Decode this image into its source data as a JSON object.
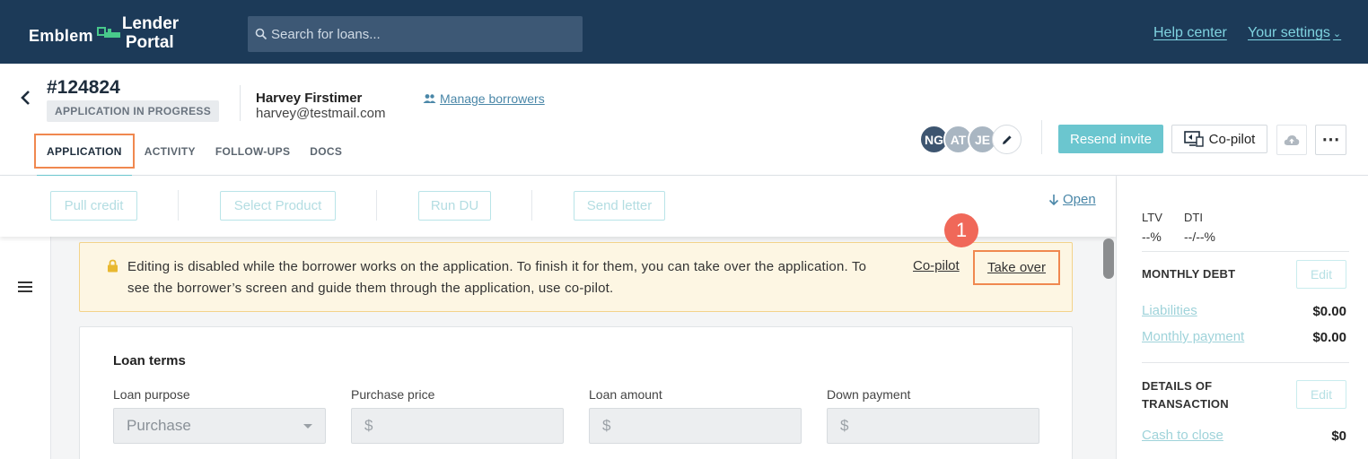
{
  "topbar": {
    "logo_emblem": "Emblem",
    "logo_line1": "Lender",
    "logo_line2": "Portal",
    "search_placeholder": "Search for loans...",
    "help_label": "Help center",
    "settings_label": "Your settings"
  },
  "header": {
    "loan_id": "#124824",
    "status": "APPLICATION IN PROGRESS",
    "borrower_name": "Harvey Firstimer",
    "borrower_email": "harvey@testmail.com",
    "manage_label": "Manage borrowers",
    "tabs": [
      {
        "label": "APPLICATION"
      },
      {
        "label": "ACTIVITY"
      },
      {
        "label": "FOLLOW-UPS"
      },
      {
        "label": "DOCS"
      }
    ],
    "avatars": [
      "NG",
      "AT",
      "JE"
    ],
    "resend_label": "Resend invite",
    "copilot_label": "Co-pilot"
  },
  "actions": {
    "pull_credit": "Pull credit",
    "select_product": "Select Product",
    "run_du": "Run DU",
    "send_letter": "Send letter",
    "open_label": "Open"
  },
  "notice": {
    "text": "Editing is disabled while the borrower works on the application. To finish it for them, you can take over the application. To see the borrower’s screen and guide them through the application, use co-pilot.",
    "copilot_link": "Co-pilot",
    "takeover_label": "Take over",
    "step_number": "1"
  },
  "loan_terms": {
    "title": "Loan terms",
    "fields": [
      {
        "label": "Loan purpose",
        "value": "Purchase"
      },
      {
        "label": "Purchase price",
        "value": "$"
      },
      {
        "label": "Loan amount",
        "value": "$"
      },
      {
        "label": "Down payment",
        "value": "$"
      }
    ]
  },
  "right_panel": {
    "ltv_label": "LTV",
    "dti_label": "DTI",
    "ltv_value": "--%",
    "dti_value": "--/--%",
    "monthly_debt_title": "MONTHLY DEBT",
    "edit_label": "Edit",
    "liabilities_label": "Liabilities",
    "liabilities_value": "$0.00",
    "monthly_payment_label": "Monthly payment",
    "monthly_payment_value": "$0.00",
    "details_title_line1": "DETAILS OF",
    "details_title_line2": "TRANSACTION",
    "cash_to_close_label": "Cash to close",
    "cash_to_close_value": "$0"
  },
  "colors": {
    "topbar_bg": "#1c3a58",
    "accent_teal": "#6bc6cf",
    "highlight_orange": "#f0884f",
    "step_badge_red": "#f06859",
    "notice_bg": "#fdf6e3"
  }
}
